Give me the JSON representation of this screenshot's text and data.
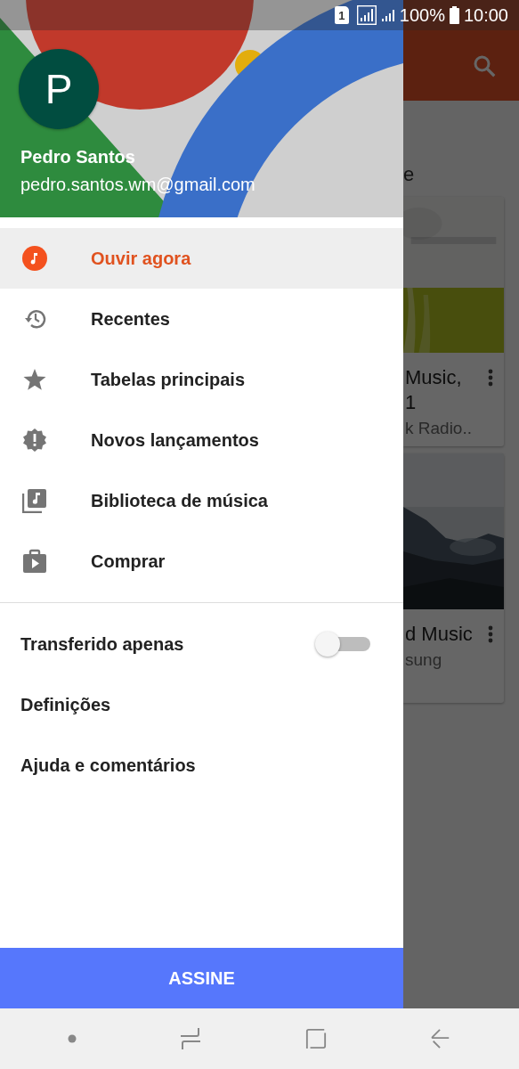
{
  "status_bar": {
    "sim": "1",
    "battery": "100%",
    "time": "10:00"
  },
  "background": {
    "heading": "e",
    "cards": [
      {
        "title_lines": [
          "Music,",
          "1"
        ],
        "subtitle": "k Radio.."
      },
      {
        "title_lines": [
          "d Music"
        ],
        "subtitle": "sung"
      }
    ]
  },
  "drawer": {
    "account": {
      "initial": "P",
      "name": "Pedro Santos",
      "email": "pedro.santos.wm@gmail.com"
    },
    "nav_items": [
      {
        "label": "Ouvir agora",
        "selected": true
      },
      {
        "label": "Recentes",
        "selected": false
      },
      {
        "label": "Tabelas principais",
        "selected": false
      },
      {
        "label": "Novos lançamentos",
        "selected": false
      },
      {
        "label": "Biblioteca de música",
        "selected": false
      },
      {
        "label": "Comprar",
        "selected": false
      }
    ],
    "settings_items": [
      {
        "kind": "toggle",
        "label": "Transferido apenas",
        "on": false
      },
      {
        "kind": "link",
        "label": "Definições"
      },
      {
        "kind": "link",
        "label": "Ajuda e comentários"
      }
    ],
    "subscribe_button": "ASSINE"
  }
}
